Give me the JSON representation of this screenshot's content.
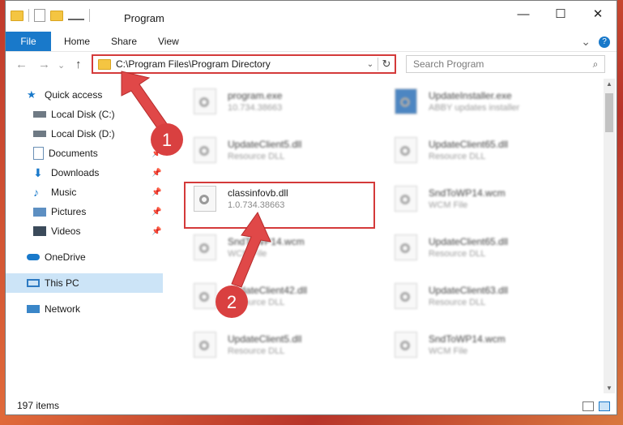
{
  "window": {
    "title": "Program"
  },
  "window_controls": {
    "minimize": "—",
    "maximize": "☐",
    "close": "✕"
  },
  "ribbon": {
    "file": "File",
    "home": "Home",
    "share": "Share",
    "view": "View",
    "expand": "⌄",
    "help": "?"
  },
  "nav": {
    "back": "←",
    "forward": "→",
    "recent": "⌄",
    "up": "↑"
  },
  "address": {
    "path": "C:\\Program Files\\Program Directory",
    "dropdown": "⌄",
    "refresh": "↻"
  },
  "search": {
    "placeholder": "Search Program",
    "icon": "⌕"
  },
  "sidebar": {
    "items": [
      {
        "label": "Quick access",
        "icon": "star-icon",
        "pinned": false
      },
      {
        "label": "Local Disk (C:)",
        "icon": "drive-icon",
        "pinned": false
      },
      {
        "label": "Local Disk (D:)",
        "icon": "drive-icon",
        "pinned": false
      },
      {
        "label": "Documents",
        "icon": "documents-icon",
        "pinned": true
      },
      {
        "label": "Downloads",
        "icon": "download-icon",
        "pinned": true
      },
      {
        "label": "Music",
        "icon": "music-icon",
        "pinned": true
      },
      {
        "label": "Pictures",
        "icon": "pictures-icon",
        "pinned": true
      },
      {
        "label": "Videos",
        "icon": "videos-icon",
        "pinned": true
      },
      {
        "label": "OneDrive",
        "icon": "cloud-icon",
        "pinned": false
      },
      {
        "label": "This PC",
        "icon": "computer-icon",
        "pinned": false
      },
      {
        "label": "Network",
        "icon": "network-icon",
        "pinned": false
      }
    ],
    "pin_glyph": "📌"
  },
  "files": [
    {
      "name": "program.exe",
      "sub": "10.734.38663"
    },
    {
      "name": "UpdateInstaller.exe",
      "sub": "ABBY updates installer"
    },
    {
      "name": "UpdateClient5.dll",
      "sub": "Resource DLL"
    },
    {
      "name": "UpdateClient65.dll",
      "sub": "Resource DLL"
    },
    {
      "name": "classinfovb.dll",
      "sub": "1.0.734.38663"
    },
    {
      "name": "SndToWP14.wcm",
      "sub": "WCM File"
    },
    {
      "name": "SndToWP14.wcm",
      "sub": "WCM File"
    },
    {
      "name": "UpdateClient65.dll",
      "sub": "Resource DLL"
    },
    {
      "name": "UpdateClient42.dll",
      "sub": "Resource DLL"
    },
    {
      "name": "UpdateClient63.dll",
      "sub": "Resource DLL"
    },
    {
      "name": "UpdateClient5.dll",
      "sub": "Resource DLL"
    },
    {
      "name": "SndToWP14.wcm",
      "sub": "WCM File"
    }
  ],
  "annotations": {
    "step1": "1",
    "step2": "2"
  },
  "status": {
    "count": "197 items"
  },
  "colors": {
    "accent": "#1979ca",
    "highlight": "#d43a3a",
    "selected": "#cce4f7"
  }
}
